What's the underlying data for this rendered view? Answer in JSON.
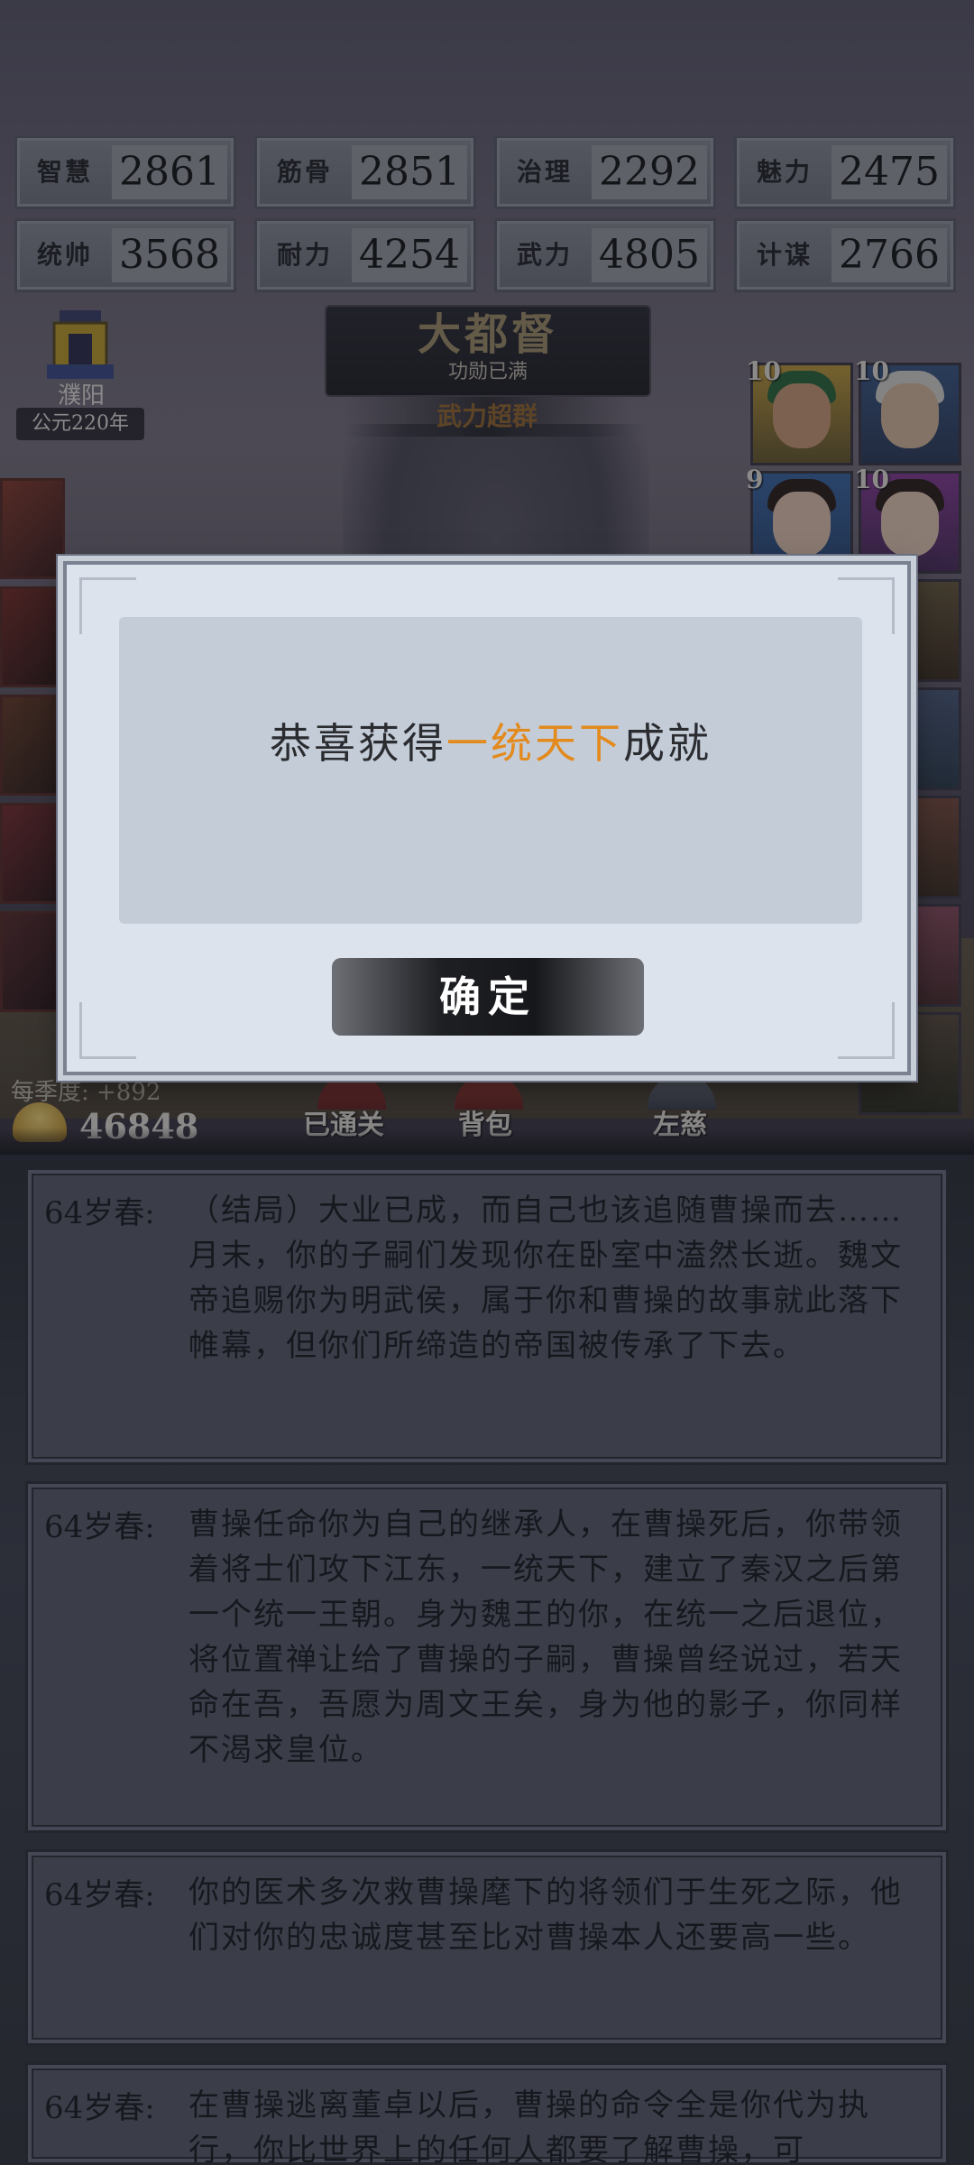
{
  "stats": [
    {
      "label": "智慧",
      "value": "2861"
    },
    {
      "label": "筋骨",
      "value": "2851"
    },
    {
      "label": "治理",
      "value": "2292"
    },
    {
      "label": "魅力",
      "value": "2475"
    },
    {
      "label": "统帅",
      "value": "3568"
    },
    {
      "label": "耐力",
      "value": "4254"
    },
    {
      "label": "武力",
      "value": "4805"
    },
    {
      "label": "计谋",
      "value": "2766"
    }
  ],
  "location": {
    "name": "濮阳",
    "year": "公元220年"
  },
  "rank": {
    "title": "大都督",
    "note": "功勋已满",
    "trait": "武力超群"
  },
  "portraits": [
    {
      "level": "10"
    },
    {
      "level": "10"
    },
    {
      "level": "9"
    },
    {
      "level": "10"
    }
  ],
  "bottom_bar": {
    "season_income": "每季度: +892",
    "gold": "46848",
    "nav": [
      "已通关",
      "背包",
      "左慈"
    ]
  },
  "modal": {
    "message_prefix": "恭喜获得",
    "message_highlight": "一统天下",
    "message_suffix": "成就",
    "confirm_label": "确定"
  },
  "log": [
    {
      "age": "64岁春:",
      "text": "（结局）大业已成，而自己也该追随曹操而去……月末，你的子嗣们发现你在卧室中溘然长逝。魏文帝追赐你为明武侯，属于你和曹操的故事就此落下帷幕，但你们所缔造的帝国被传承了下去。"
    },
    {
      "age": "64岁春:",
      "text": "曹操任命你为自己的继承人，在曹操死后，你带领着将士们攻下江东，一统天下，建立了秦汉之后第一个统一王朝。身为魏王的你，在统一之后退位，将位置禅让给了曹操的子嗣，曹操曾经说过，若天命在吾，吾愿为周文王矣，身为他的影子，你同样不渴求皇位。"
    },
    {
      "age": "64岁春:",
      "text": "你的医术多次救曹操麾下的将领们于生死之际，他们对你的忠诚度甚至比对曹操本人还要高一些。"
    },
    {
      "age": "64岁春:",
      "text": "在曹操逃离董卓以后，曹操的命令全是你代为执行，你比世界上的任何人都要了解曹操，可"
    }
  ]
}
